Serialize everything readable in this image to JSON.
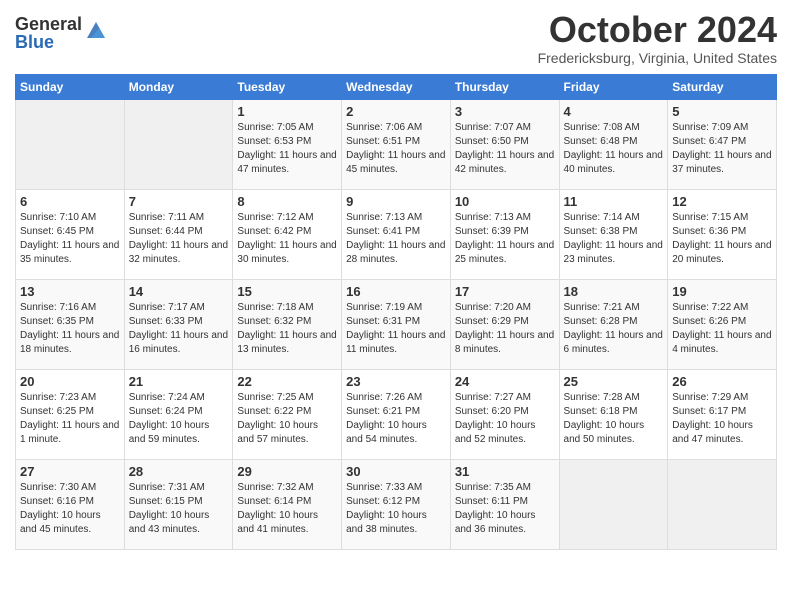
{
  "header": {
    "logo_general": "General",
    "logo_blue": "Blue",
    "title": "October 2024",
    "location": "Fredericksburg, Virginia, United States"
  },
  "days_of_week": [
    "Sunday",
    "Monday",
    "Tuesday",
    "Wednesday",
    "Thursday",
    "Friday",
    "Saturday"
  ],
  "weeks": [
    [
      {
        "day": "",
        "sunrise": "",
        "sunset": "",
        "daylight": ""
      },
      {
        "day": "",
        "sunrise": "",
        "sunset": "",
        "daylight": ""
      },
      {
        "day": "1",
        "sunrise": "Sunrise: 7:05 AM",
        "sunset": "Sunset: 6:53 PM",
        "daylight": "Daylight: 11 hours and 47 minutes."
      },
      {
        "day": "2",
        "sunrise": "Sunrise: 7:06 AM",
        "sunset": "Sunset: 6:51 PM",
        "daylight": "Daylight: 11 hours and 45 minutes."
      },
      {
        "day": "3",
        "sunrise": "Sunrise: 7:07 AM",
        "sunset": "Sunset: 6:50 PM",
        "daylight": "Daylight: 11 hours and 42 minutes."
      },
      {
        "day": "4",
        "sunrise": "Sunrise: 7:08 AM",
        "sunset": "Sunset: 6:48 PM",
        "daylight": "Daylight: 11 hours and 40 minutes."
      },
      {
        "day": "5",
        "sunrise": "Sunrise: 7:09 AM",
        "sunset": "Sunset: 6:47 PM",
        "daylight": "Daylight: 11 hours and 37 minutes."
      }
    ],
    [
      {
        "day": "6",
        "sunrise": "Sunrise: 7:10 AM",
        "sunset": "Sunset: 6:45 PM",
        "daylight": "Daylight: 11 hours and 35 minutes."
      },
      {
        "day": "7",
        "sunrise": "Sunrise: 7:11 AM",
        "sunset": "Sunset: 6:44 PM",
        "daylight": "Daylight: 11 hours and 32 minutes."
      },
      {
        "day": "8",
        "sunrise": "Sunrise: 7:12 AM",
        "sunset": "Sunset: 6:42 PM",
        "daylight": "Daylight: 11 hours and 30 minutes."
      },
      {
        "day": "9",
        "sunrise": "Sunrise: 7:13 AM",
        "sunset": "Sunset: 6:41 PM",
        "daylight": "Daylight: 11 hours and 28 minutes."
      },
      {
        "day": "10",
        "sunrise": "Sunrise: 7:13 AM",
        "sunset": "Sunset: 6:39 PM",
        "daylight": "Daylight: 11 hours and 25 minutes."
      },
      {
        "day": "11",
        "sunrise": "Sunrise: 7:14 AM",
        "sunset": "Sunset: 6:38 PM",
        "daylight": "Daylight: 11 hours and 23 minutes."
      },
      {
        "day": "12",
        "sunrise": "Sunrise: 7:15 AM",
        "sunset": "Sunset: 6:36 PM",
        "daylight": "Daylight: 11 hours and 20 minutes."
      }
    ],
    [
      {
        "day": "13",
        "sunrise": "Sunrise: 7:16 AM",
        "sunset": "Sunset: 6:35 PM",
        "daylight": "Daylight: 11 hours and 18 minutes."
      },
      {
        "day": "14",
        "sunrise": "Sunrise: 7:17 AM",
        "sunset": "Sunset: 6:33 PM",
        "daylight": "Daylight: 11 hours and 16 minutes."
      },
      {
        "day": "15",
        "sunrise": "Sunrise: 7:18 AM",
        "sunset": "Sunset: 6:32 PM",
        "daylight": "Daylight: 11 hours and 13 minutes."
      },
      {
        "day": "16",
        "sunrise": "Sunrise: 7:19 AM",
        "sunset": "Sunset: 6:31 PM",
        "daylight": "Daylight: 11 hours and 11 minutes."
      },
      {
        "day": "17",
        "sunrise": "Sunrise: 7:20 AM",
        "sunset": "Sunset: 6:29 PM",
        "daylight": "Daylight: 11 hours and 8 minutes."
      },
      {
        "day": "18",
        "sunrise": "Sunrise: 7:21 AM",
        "sunset": "Sunset: 6:28 PM",
        "daylight": "Daylight: 11 hours and 6 minutes."
      },
      {
        "day": "19",
        "sunrise": "Sunrise: 7:22 AM",
        "sunset": "Sunset: 6:26 PM",
        "daylight": "Daylight: 11 hours and 4 minutes."
      }
    ],
    [
      {
        "day": "20",
        "sunrise": "Sunrise: 7:23 AM",
        "sunset": "Sunset: 6:25 PM",
        "daylight": "Daylight: 11 hours and 1 minute."
      },
      {
        "day": "21",
        "sunrise": "Sunrise: 7:24 AM",
        "sunset": "Sunset: 6:24 PM",
        "daylight": "Daylight: 10 hours and 59 minutes."
      },
      {
        "day": "22",
        "sunrise": "Sunrise: 7:25 AM",
        "sunset": "Sunset: 6:22 PM",
        "daylight": "Daylight: 10 hours and 57 minutes."
      },
      {
        "day": "23",
        "sunrise": "Sunrise: 7:26 AM",
        "sunset": "Sunset: 6:21 PM",
        "daylight": "Daylight: 10 hours and 54 minutes."
      },
      {
        "day": "24",
        "sunrise": "Sunrise: 7:27 AM",
        "sunset": "Sunset: 6:20 PM",
        "daylight": "Daylight: 10 hours and 52 minutes."
      },
      {
        "day": "25",
        "sunrise": "Sunrise: 7:28 AM",
        "sunset": "Sunset: 6:18 PM",
        "daylight": "Daylight: 10 hours and 50 minutes."
      },
      {
        "day": "26",
        "sunrise": "Sunrise: 7:29 AM",
        "sunset": "Sunset: 6:17 PM",
        "daylight": "Daylight: 10 hours and 47 minutes."
      }
    ],
    [
      {
        "day": "27",
        "sunrise": "Sunrise: 7:30 AM",
        "sunset": "Sunset: 6:16 PM",
        "daylight": "Daylight: 10 hours and 45 minutes."
      },
      {
        "day": "28",
        "sunrise": "Sunrise: 7:31 AM",
        "sunset": "Sunset: 6:15 PM",
        "daylight": "Daylight: 10 hours and 43 minutes."
      },
      {
        "day": "29",
        "sunrise": "Sunrise: 7:32 AM",
        "sunset": "Sunset: 6:14 PM",
        "daylight": "Daylight: 10 hours and 41 minutes."
      },
      {
        "day": "30",
        "sunrise": "Sunrise: 7:33 AM",
        "sunset": "Sunset: 6:12 PM",
        "daylight": "Daylight: 10 hours and 38 minutes."
      },
      {
        "day": "31",
        "sunrise": "Sunrise: 7:35 AM",
        "sunset": "Sunset: 6:11 PM",
        "daylight": "Daylight: 10 hours and 36 minutes."
      },
      {
        "day": "",
        "sunrise": "",
        "sunset": "",
        "daylight": ""
      },
      {
        "day": "",
        "sunrise": "",
        "sunset": "",
        "daylight": ""
      }
    ]
  ]
}
